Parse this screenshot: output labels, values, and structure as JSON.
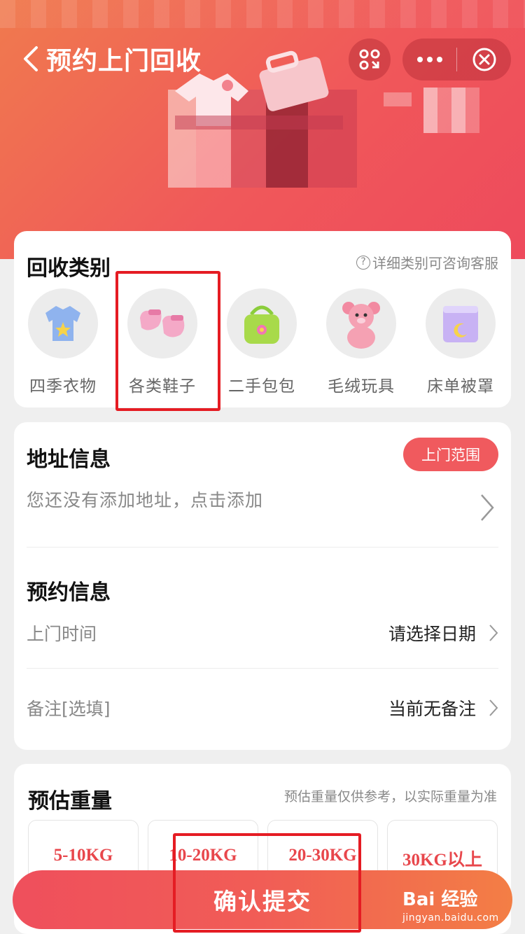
{
  "header": {
    "title": "预约上门回收",
    "back_icon": "chevron-left-icon",
    "scan_icon": "scan-icon",
    "more_icon": "more-dots-icon",
    "close_icon": "close-circle-icon"
  },
  "category": {
    "title": "回收类别",
    "hint": "详细类别可咨询客服",
    "items": [
      {
        "label": "四季衣物",
        "icon": "tshirt-icon"
      },
      {
        "label": "各类鞋子",
        "icon": "shoes-icon"
      },
      {
        "label": "二手包包",
        "icon": "bag-icon"
      },
      {
        "label": "毛绒玩具",
        "icon": "teddy-bear-icon"
      },
      {
        "label": "床单被罩",
        "icon": "bedding-icon"
      }
    ]
  },
  "address": {
    "title": "地址信息",
    "range_button": "上门范围",
    "empty_text": "您还没有添加地址，点击添加"
  },
  "booking": {
    "title": "预约信息",
    "time_label": "上门时间",
    "time_value": "请选择日期",
    "note_label": "备注[选填]",
    "note_value": "当前无备注"
  },
  "weight": {
    "title": "预估重量",
    "hint": "预估重量仅供参考，以实际重量为准",
    "options": [
      "5-10KG",
      "10-20KG",
      "20-30KG",
      "30KG以上"
    ]
  },
  "submit_label": "确认提交",
  "watermark": {
    "logo": "Bai  经验",
    "url": "jingyan.baidu.com"
  },
  "colors": {
    "accent": "#f05a5e",
    "highlight": "#e51c23",
    "header_start": "#f07a4e",
    "header_end": "#ee4a5c"
  }
}
